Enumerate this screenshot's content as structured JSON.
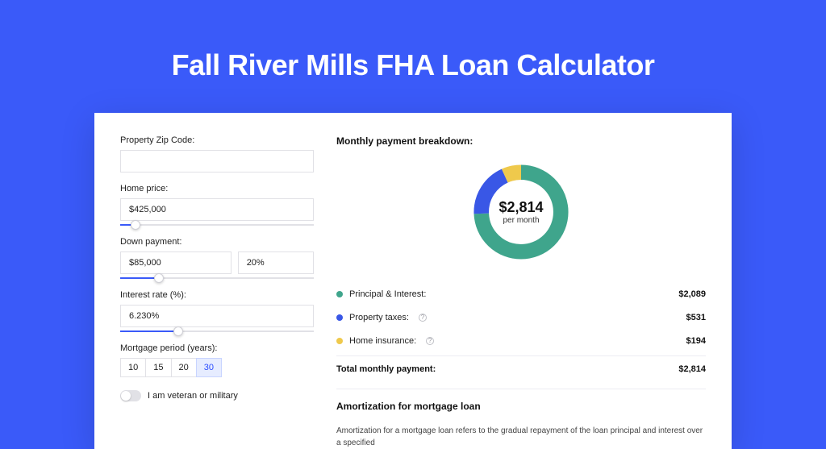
{
  "page": {
    "title": "Fall River Mills FHA Loan Calculator"
  },
  "form": {
    "zip_label": "Property Zip Code:",
    "zip_value": "",
    "home_price_label": "Home price:",
    "home_price_value": "$425,000",
    "home_price_slider_pct": 8,
    "down_payment_label": "Down payment:",
    "down_payment_value": "$85,000",
    "down_payment_pct": "20%",
    "down_payment_slider_pct": 20,
    "interest_label": "Interest rate (%):",
    "interest_value": "6.230%",
    "interest_slider_pct": 30,
    "period_label": "Mortgage period (years):",
    "period_options": [
      "10",
      "15",
      "20",
      "30"
    ],
    "period_selected_index": 3,
    "veteran_label": "I am veteran or military",
    "veteran_on": false
  },
  "breakdown": {
    "title": "Monthly payment breakdown:",
    "donut_value": "$2,814",
    "donut_sub": "per month",
    "items": [
      {
        "label": "Principal & Interest:",
        "value": "$2,089",
        "color": "#3fa58c",
        "info": false
      },
      {
        "label": "Property taxes:",
        "value": "$531",
        "color": "#3957e6",
        "info": true
      },
      {
        "label": "Home insurance:",
        "value": "$194",
        "color": "#efc94c",
        "info": true
      }
    ],
    "total_label": "Total monthly payment:",
    "total_value": "$2,814"
  },
  "chart_data": {
    "type": "pie",
    "title": "Monthly payment breakdown",
    "series": [
      {
        "name": "Principal & Interest",
        "value": 2089,
        "color": "#3fa58c"
      },
      {
        "name": "Property taxes",
        "value": 531,
        "color": "#3957e6"
      },
      {
        "name": "Home insurance",
        "value": 194,
        "color": "#efc94c"
      }
    ],
    "total": 2814,
    "center_label": "$2,814 per month"
  },
  "amort": {
    "title": "Amortization for mortgage loan",
    "body": "Amortization for a mortgage loan refers to the gradual repayment of the loan principal and interest over a specified"
  }
}
